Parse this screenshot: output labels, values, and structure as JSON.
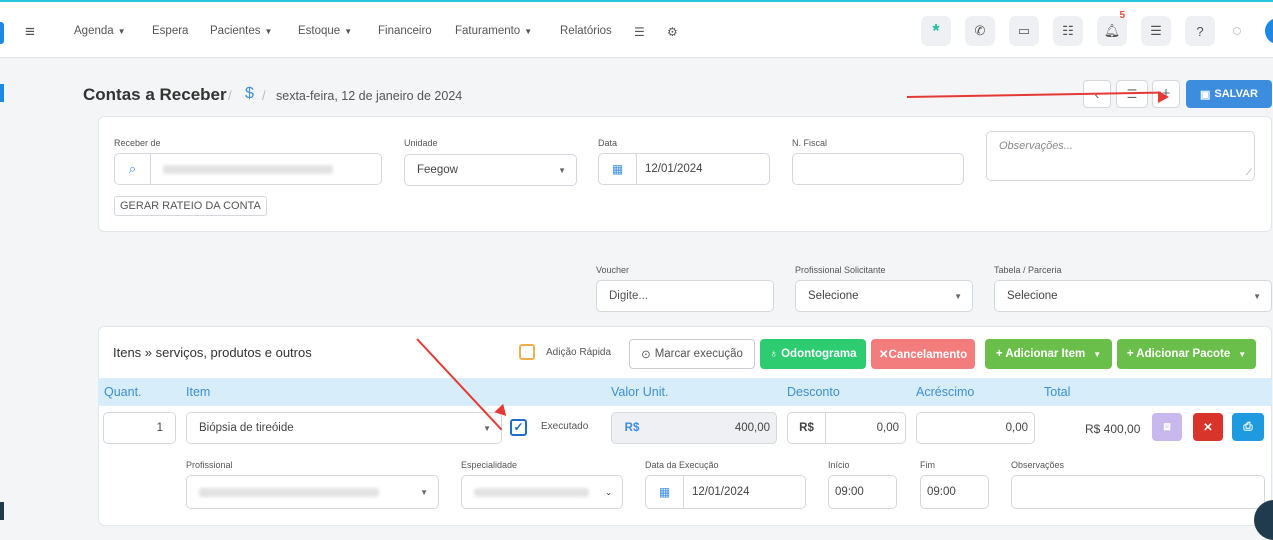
{
  "nav": {
    "items": [
      {
        "label": "Agenda",
        "dropdown": true
      },
      {
        "label": "Espera",
        "dropdown": false
      },
      {
        "label": "Pacientes",
        "dropdown": true
      },
      {
        "label": "Estoque",
        "dropdown": true
      },
      {
        "label": "Financeiro",
        "dropdown": false
      },
      {
        "label": "Faturamento",
        "dropdown": true
      },
      {
        "label": "Relatórios",
        "dropdown": false
      }
    ],
    "notification_count": "5"
  },
  "header": {
    "title": "Contas a Receber",
    "currency_symbol": "$",
    "date": "sexta-feira, 12 de janeiro de 2024",
    "add_label": "+",
    "save_label": "SALVAR"
  },
  "form": {
    "receber_de_label": "Receber de",
    "unidade_label": "Unidade",
    "unidade_value": "Feegow",
    "data_label": "Data",
    "data_value": "12/01/2024",
    "nfiscal_label": "N. Fiscal",
    "obs_placeholder": "Observações...",
    "rateio_label": "GERAR RATEIO DA CONTA",
    "voucher_label": "Voucher",
    "voucher_placeholder": "Digite...",
    "prof_sol_label": "Profissional Solicitante",
    "prof_sol_value": "Selecione",
    "tabela_label": "Tabela / Parceria",
    "tabela_value": "Selecione"
  },
  "items": {
    "title": "Itens » serviços, produtos e outros",
    "quick_add_label": "Adição Rápida",
    "mark_exec_label": "Marcar execução",
    "odonto_label": "Odontograma",
    "cancel_label": "✕Cancelamento",
    "add_item_label": "+ Adicionar Item",
    "add_package_label": "+ Adicionar Pacote",
    "columns": [
      "Quant.",
      "Item",
      "Valor Unit.",
      "Desconto",
      "Acréscimo",
      "Total"
    ],
    "row": {
      "quantity": "1",
      "item": "Biópsia de tireóide",
      "executed_label": "Executado",
      "currency": "R$",
      "unit_value": "400,00",
      "discount_currency": "R$",
      "discount": "0,00",
      "increase": "0,00",
      "total": "R$ 400,00"
    },
    "detail": {
      "prof_label": "Profissional",
      "esp_label": "Especialidade",
      "data_exec_label": "Data da Execução",
      "data_exec_value": "12/01/2024",
      "inicio_label": "Início",
      "inicio_value": "09:00",
      "fim_label": "Fim",
      "fim_value": "09:00",
      "obs_label": "Observações"
    }
  },
  "colors": {
    "primary": "#3c8dde",
    "success": "#2ecc71",
    "green": "#6abf4b",
    "danger": "#f37c7c",
    "red": "#d9342b",
    "info": "#1e9be0",
    "purple": "#c8b8ee",
    "annotation": "#e53935"
  }
}
